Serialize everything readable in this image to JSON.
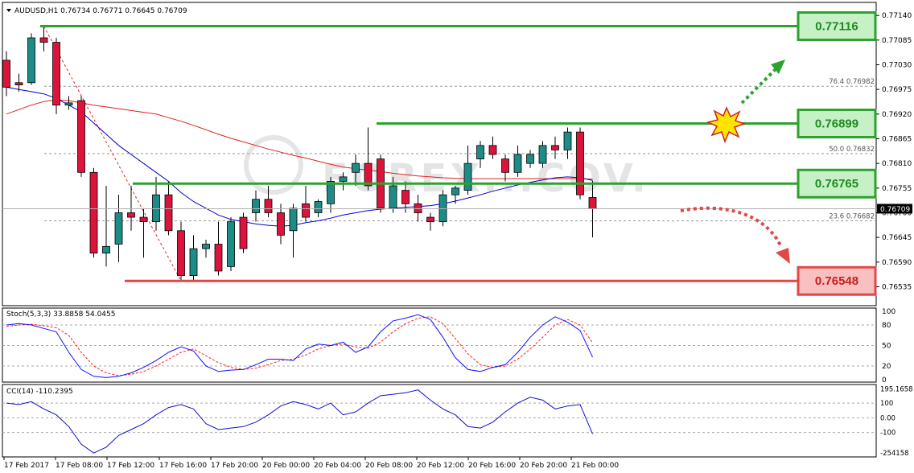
{
  "chart_data": {
    "type": "candlestick",
    "symbol_header": "AUDUSD,H1  0.76734 0.76771 0.76645 0.76709",
    "watermark": "FOREX...COV.",
    "colors": {
      "bull": "#1e8c86",
      "bear": "#dc143c",
      "ma_fast": "#0000cd",
      "ma_slow": "#dd2222",
      "resistance": "#2ea12e",
      "support": "#e04848",
      "label_green_fill": "#c6f0c6",
      "label_red_fill": "#f8c0c0",
      "stoch_main": "#1010ff",
      "stoch_signal": "#ff2020",
      "cci": "#1010cc"
    },
    "main_panel": {
      "ylim": [
        0.765,
        0.7716
      ],
      "price_ticks": [
        "0.77140",
        "0.77085",
        "0.77030",
        "0.76975",
        "0.76920",
        "0.76865",
        "0.76810",
        "0.76755",
        "0.76700",
        "0.76645",
        "0.76590",
        "0.76535"
      ],
      "price_tick_values": [
        0.7714,
        0.77085,
        0.7703,
        0.76975,
        0.7692,
        0.76865,
        0.7681,
        0.76755,
        0.767,
        0.76645,
        0.7659,
        0.76535
      ],
      "current_price": "0.76709",
      "current_price_value": 0.76709,
      "candles": [
        {
          "o": 0.7704,
          "h": 0.7706,
          "l": 0.7696,
          "c": 0.7698
        },
        {
          "o": 0.7699,
          "h": 0.7701,
          "l": 0.7697,
          "c": 0.76985
        },
        {
          "o": 0.7699,
          "h": 0.771,
          "l": 0.76985,
          "c": 0.7709
        },
        {
          "o": 0.7709,
          "h": 0.77116,
          "l": 0.7706,
          "c": 0.7708
        },
        {
          "o": 0.7708,
          "h": 0.7709,
          "l": 0.7692,
          "c": 0.7694
        },
        {
          "o": 0.7694,
          "h": 0.7696,
          "l": 0.7693,
          "c": 0.76945
        },
        {
          "o": 0.7695,
          "h": 0.7696,
          "l": 0.7678,
          "c": 0.7679
        },
        {
          "o": 0.7679,
          "h": 0.768,
          "l": 0.766,
          "c": 0.7661
        },
        {
          "o": 0.7661,
          "h": 0.7676,
          "l": 0.7658,
          "c": 0.76625
        },
        {
          "o": 0.7663,
          "h": 0.7674,
          "l": 0.7659,
          "c": 0.767
        },
        {
          "o": 0.767,
          "h": 0.7676,
          "l": 0.7666,
          "c": 0.7669
        },
        {
          "o": 0.7669,
          "h": 0.7671,
          "l": 0.766,
          "c": 0.7668
        },
        {
          "o": 0.7668,
          "h": 0.7678,
          "l": 0.7666,
          "c": 0.7674
        },
        {
          "o": 0.7674,
          "h": 0.7677,
          "l": 0.7665,
          "c": 0.7666
        },
        {
          "o": 0.7666,
          "h": 0.7668,
          "l": 0.76548,
          "c": 0.7656
        },
        {
          "o": 0.7656,
          "h": 0.7665,
          "l": 0.7655,
          "c": 0.7662
        },
        {
          "o": 0.7662,
          "h": 0.7664,
          "l": 0.766,
          "c": 0.7663
        },
        {
          "o": 0.7663,
          "h": 0.7668,
          "l": 0.7656,
          "c": 0.7657
        },
        {
          "o": 0.7658,
          "h": 0.7669,
          "l": 0.7657,
          "c": 0.7668
        },
        {
          "o": 0.7669,
          "h": 0.767,
          "l": 0.7661,
          "c": 0.7662
        },
        {
          "o": 0.767,
          "h": 0.7675,
          "l": 0.7668,
          "c": 0.7673
        },
        {
          "o": 0.7673,
          "h": 0.7676,
          "l": 0.7669,
          "c": 0.767
        },
        {
          "o": 0.767,
          "h": 0.7672,
          "l": 0.7663,
          "c": 0.7665
        },
        {
          "o": 0.7666,
          "h": 0.7672,
          "l": 0.766,
          "c": 0.7671
        },
        {
          "o": 0.7672,
          "h": 0.7676,
          "l": 0.7668,
          "c": 0.7669
        },
        {
          "o": 0.767,
          "h": 0.7673,
          "l": 0.7669,
          "c": 0.76725
        },
        {
          "o": 0.7672,
          "h": 0.7678,
          "l": 0.767,
          "c": 0.7677
        },
        {
          "o": 0.7677,
          "h": 0.7679,
          "l": 0.7675,
          "c": 0.7678
        },
        {
          "o": 0.7679,
          "h": 0.7683,
          "l": 0.7676,
          "c": 0.7681
        },
        {
          "o": 0.7681,
          "h": 0.7689,
          "l": 0.7675,
          "c": 0.7676
        },
        {
          "o": 0.7682,
          "h": 0.7683,
          "l": 0.767,
          "c": 0.7671
        },
        {
          "o": 0.7671,
          "h": 0.7678,
          "l": 0.767,
          "c": 0.7676
        },
        {
          "o": 0.7675,
          "h": 0.7677,
          "l": 0.767,
          "c": 0.7672
        },
        {
          "o": 0.7672,
          "h": 0.7674,
          "l": 0.7668,
          "c": 0.767
        },
        {
          "o": 0.7669,
          "h": 0.767,
          "l": 0.7666,
          "c": 0.7668
        },
        {
          "o": 0.7668,
          "h": 0.7675,
          "l": 0.7667,
          "c": 0.7674
        },
        {
          "o": 0.7674,
          "h": 0.7676,
          "l": 0.7672,
          "c": 0.76755
        },
        {
          "o": 0.7675,
          "h": 0.7685,
          "l": 0.7674,
          "c": 0.7681
        },
        {
          "o": 0.7682,
          "h": 0.7686,
          "l": 0.768,
          "c": 0.7685
        },
        {
          "o": 0.7685,
          "h": 0.7687,
          "l": 0.7682,
          "c": 0.7683
        },
        {
          "o": 0.7682,
          "h": 0.7683,
          "l": 0.7677,
          "c": 0.7679
        },
        {
          "o": 0.7679,
          "h": 0.7685,
          "l": 0.7678,
          "c": 0.7683
        },
        {
          "o": 0.7681,
          "h": 0.7684,
          "l": 0.768,
          "c": 0.7683
        },
        {
          "o": 0.7681,
          "h": 0.7686,
          "l": 0.768,
          "c": 0.7685
        },
        {
          "o": 0.7685,
          "h": 0.7687,
          "l": 0.7682,
          "c": 0.7684
        },
        {
          "o": 0.7684,
          "h": 0.7689,
          "l": 0.7682,
          "c": 0.7688
        },
        {
          "o": 0.7688,
          "h": 0.7689,
          "l": 0.7673,
          "c": 0.7674
        },
        {
          "o": 0.76734,
          "h": 0.76771,
          "l": 0.76645,
          "c": 0.76709
        }
      ],
      "ma_fast": [
        0.7698,
        0.76975,
        0.7697,
        0.76965,
        0.76955,
        0.7694,
        0.76925,
        0.769,
        0.76875,
        0.7685,
        0.7683,
        0.7681,
        0.7679,
        0.7677,
        0.76745,
        0.76725,
        0.7671,
        0.76695,
        0.76685,
        0.7668,
        0.76675,
        0.76672,
        0.7667,
        0.76672,
        0.76678,
        0.76682,
        0.76688,
        0.76695,
        0.767,
        0.76705,
        0.76708,
        0.7671,
        0.76712,
        0.76714,
        0.76716,
        0.7672,
        0.76726,
        0.76733,
        0.7674,
        0.76748,
        0.76755,
        0.76762,
        0.76768,
        0.76773,
        0.76778,
        0.7678,
        0.76778,
        0.76772
      ],
      "ma_slow": [
        0.7692,
        0.7693,
        0.7694,
        0.76948,
        0.76952,
        0.7695,
        0.76945,
        0.7694,
        0.76936,
        0.76932,
        0.76928,
        0.76924,
        0.7692,
        0.76912,
        0.76904,
        0.76895,
        0.76885,
        0.76875,
        0.76866,
        0.76858,
        0.7685,
        0.76842,
        0.76835,
        0.76828,
        0.76822,
        0.76815,
        0.76808,
        0.76802,
        0.76798,
        0.76795,
        0.76792,
        0.76788,
        0.76785,
        0.76782,
        0.7678,
        0.76778,
        0.76777,
        0.76776,
        0.76776,
        0.76776,
        0.76776,
        0.76776,
        0.76776,
        0.76776,
        0.76776,
        0.76776,
        0.76776,
        0.76775
      ],
      "levels": [
        {
          "value": 0.77116,
          "label": "0.77116",
          "kind": "resistance"
        },
        {
          "value": 0.76899,
          "label": "0.76899",
          "kind": "resistance"
        },
        {
          "value": 0.76765,
          "label": "0.76765",
          "kind": "resistance"
        },
        {
          "value": 0.76548,
          "label": "0.76548",
          "kind": "support"
        }
      ],
      "fibonacci": [
        {
          "value": 0.76982,
          "label": "76.4 0.76982"
        },
        {
          "value": 0.76832,
          "label": "50.0 0.76832"
        },
        {
          "value": 0.76682,
          "label": "23.6 0.76682"
        }
      ]
    },
    "stoch_panel": {
      "header": "Stoch(5,3,3) 33.8858 54.0455",
      "ylim": [
        0,
        100
      ],
      "ticks": [
        "100",
        "80",
        "50",
        "20",
        "0"
      ],
      "tick_values": [
        100,
        80,
        50,
        20,
        0
      ],
      "main": [
        80,
        82,
        80,
        75,
        70,
        40,
        15,
        5,
        3,
        5,
        10,
        18,
        28,
        40,
        48,
        42,
        20,
        12,
        14,
        15,
        22,
        30,
        30,
        28,
        45,
        52,
        50,
        55,
        40,
        48,
        70,
        86,
        90,
        95,
        88,
        62,
        32,
        15,
        12,
        18,
        22,
        40,
        62,
        80,
        92,
        84,
        72,
        33
      ],
      "signal": [
        78,
        80,
        81,
        79,
        76,
        65,
        40,
        20,
        10,
        6,
        8,
        12,
        20,
        30,
        40,
        45,
        35,
        25,
        18,
        15,
        17,
        22,
        28,
        30,
        36,
        45,
        50,
        52,
        48,
        46,
        55,
        70,
        82,
        90,
        92,
        82,
        60,
        38,
        22,
        18,
        20,
        30,
        45,
        62,
        80,
        88,
        80,
        54
      ]
    },
    "cci_panel": {
      "header": "CCI(14) -110.2395",
      "ylim": [
        -250,
        210
      ],
      "ticks": [
        "195.1658",
        "100",
        "0.00",
        "-100",
        "-254158"
      ],
      "tick_values": [
        195.1658,
        100,
        0,
        -100,
        -250
      ],
      "values": [
        100,
        90,
        110,
        60,
        20,
        -60,
        -180,
        -240,
        -200,
        -120,
        -80,
        -40,
        20,
        70,
        90,
        60,
        -40,
        -80,
        -70,
        -60,
        -30,
        20,
        80,
        110,
        90,
        60,
        100,
        20,
        40,
        100,
        150,
        160,
        170,
        190,
        120,
        60,
        20,
        -60,
        -70,
        -30,
        40,
        100,
        140,
        120,
        60,
        80,
        90,
        -110
      ]
    },
    "x_ticks": [
      "17 Feb 2017",
      "17 Feb 08:00",
      "17 Feb 12:00",
      "17 Feb 16:00",
      "17 Feb 20:00",
      "20 Feb 00:00",
      "20 Feb 04:00",
      "20 Feb 08:00",
      "20 Feb 12:00",
      "20 Feb 16:00",
      "20 Feb 20:00",
      "21 Feb 00:00"
    ],
    "x_tick_index": [
      0,
      4,
      8,
      12,
      16,
      20,
      24,
      28,
      32,
      36,
      40,
      44
    ]
  }
}
